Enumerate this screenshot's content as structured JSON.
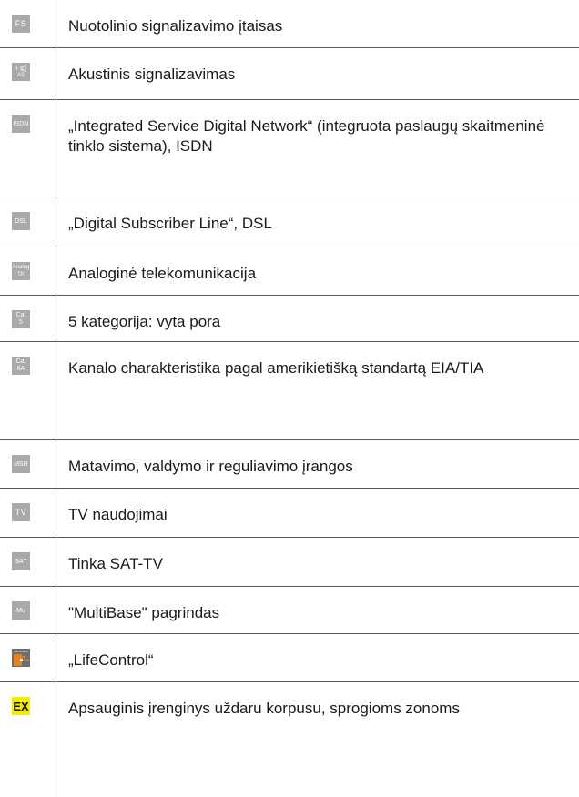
{
  "rows": [
    {
      "icon": "FS",
      "text": "Nuotolinio signalizavimo įtaisas"
    },
    {
      "icon": "AS",
      "text": "Akustinis signalizavimas"
    },
    {
      "icon": "ISDN",
      "text": "„Integrated Service Digital Network“ (integruota paslaugų skaitmeninė tinklo sistema), ISDN"
    },
    {
      "icon": "DSL",
      "text": "„Digital Subscriber Line“, DSL"
    },
    {
      "icon": "Analog TK",
      "icon_line1": "Analog",
      "icon_line2": "TK",
      "text": "Analoginė telekomunikacija"
    },
    {
      "icon": "Cat 5",
      "icon_line1": "Cat",
      "icon_line2": "5",
      "text": "5 kategorija: vyta pora"
    },
    {
      "icon": "Cat 6A",
      "icon_line1": "Cat",
      "icon_line2": "6A",
      "text": "Kanalo charakteristika pagal amerikietišką standartą EIA/TIA"
    },
    {
      "icon": "MSR",
      "text": "Matavimo, valdymo ir reguliavimo įrangos"
    },
    {
      "icon": "TV",
      "text": "TV naudojimai"
    },
    {
      "icon": "SAT",
      "text": "Tinka SAT-TV"
    },
    {
      "icon": "Mu",
      "text": "\"MultiBase\" pagrindas"
    },
    {
      "icon": "Life Control",
      "text": "„LifeControl“"
    },
    {
      "icon": "EX",
      "text": "Apsauginis įrenginys uždaru korpusu, sprogioms zonoms"
    }
  ],
  "colors": {
    "icon_gray": "#a9a9a9",
    "ex_yellow": "#f6ea00",
    "lifecontrol_orange": "#e8821e",
    "border": "#5a5a5a"
  }
}
